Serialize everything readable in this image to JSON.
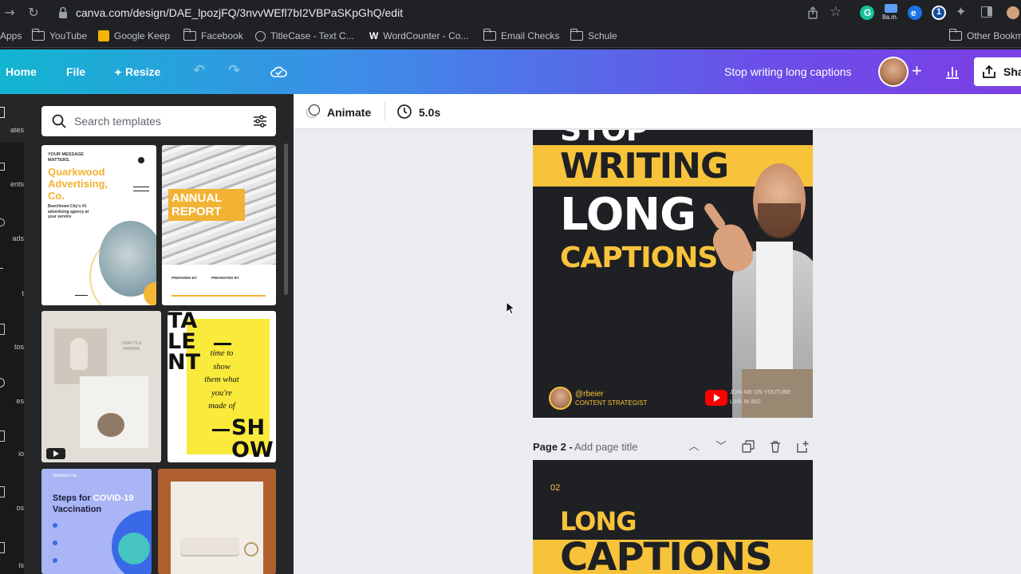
{
  "browser": {
    "url": "canva.com/design/DAE_lpozjFQ/3nvvWEfl7bI2VBPaSKpGhQ/edit",
    "ext_badge": "8a.m."
  },
  "bookmarks": {
    "apps": "Apps",
    "items": [
      "YouTube",
      "Google Keep",
      "Facebook",
      "TitleCase - Text C...",
      "WordCounter - Co...",
      "Email Checks",
      "Schule"
    ],
    "other": "Other Bookm"
  },
  "canva": {
    "home": "Home",
    "file": "File",
    "resize": "Resize",
    "design_title": "Stop writing long captions",
    "share": "Sha"
  },
  "rail": {
    "labels": [
      "ates",
      "ents",
      "ads",
      "t",
      "tos",
      "es",
      "io",
      "os",
      "is"
    ]
  },
  "panel": {
    "search_placeholder": "Search templates",
    "t1": {
      "kicker": "YOUR MESSAGE MATTERS.",
      "title": "Quarkwood Advertising, Co.",
      "sub": "Beechtown City's #1 advertising agency at your service"
    },
    "t2": {
      "title": "ANNUAL REPORT",
      "prepared": "PREPARED BY",
      "presented": "PRESENTED BY"
    },
    "t3": {
      "brand": "CRAFTS & PAPERIE"
    },
    "t4": {
      "talent": "TA LE NT",
      "body": "time to show them what you're made of",
      "show": "SH OW"
    },
    "t5": {
      "kicker": "Westfield City",
      "title_a": "Steps for ",
      "title_b": "COVID-19",
      "title_c": "Vaccination"
    }
  },
  "toolbar": {
    "animate": "Animate",
    "duration": "5.0s"
  },
  "page1": {
    "line0": "STOP",
    "line1": "WRITING",
    "line2": "LONG",
    "line3": "CAPTIONS",
    "handle": "@rbeier",
    "role": "CONTENT STRATEGIST",
    "yt1": "JOIN ME ON YOUTUBE",
    "yt2": "LINK IN BIO"
  },
  "page2_bar": {
    "label": "Page 2 - ",
    "title_placeholder": "Add page title"
  },
  "page2": {
    "num": "02",
    "line1": "LONG",
    "line2": "CAPTIONS"
  },
  "colors": {
    "accent_yellow": "#f7c33a",
    "dark_bg": "#1f2023",
    "canva_gradient_start": "#12b5d0",
    "canva_gradient_end": "#7b3fe4"
  }
}
